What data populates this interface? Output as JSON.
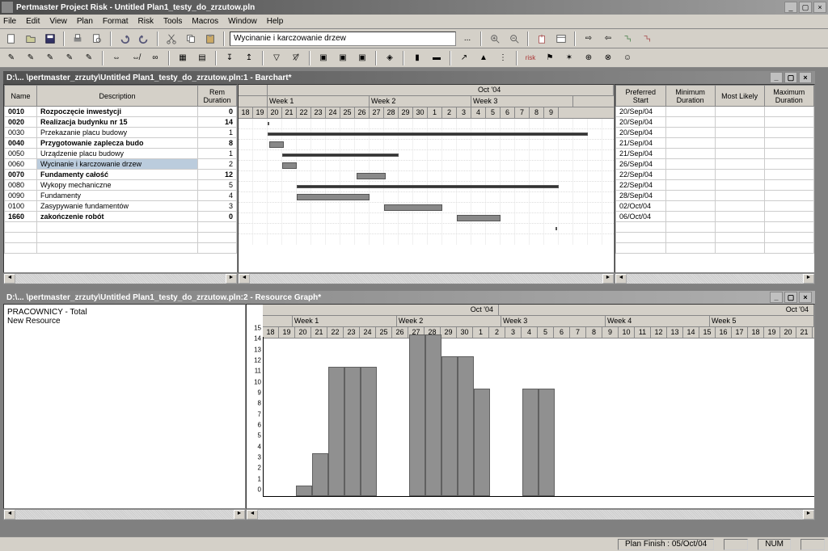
{
  "app": {
    "title": "Pertmaster Project Risk - Untitled Plan1_testy_do_zrzutow.pln"
  },
  "menu": [
    "File",
    "Edit",
    "View",
    "Plan",
    "Format",
    "Risk",
    "Tools",
    "Macros",
    "Window",
    "Help"
  ],
  "toolbar_input": "Wycinanie i karczowanie drzew",
  "win1": {
    "title": "D:\\... \\pertmaster_zrzuty\\Untitled Plan1_testy_do_zrzutow.pln:1 - Barchart*",
    "cols_left": [
      "Name",
      "Description",
      "Rem Duration"
    ],
    "cols_right": [
      "Preferred Start",
      "Minimum Duration",
      "Most Likely",
      "Maximum Duration"
    ],
    "timeline_month": "Oct '04",
    "timeline_weeks": [
      "Week 1",
      "Week 2",
      "Week 3"
    ],
    "timeline_days": [
      "18",
      "19",
      "20",
      "21",
      "22",
      "23",
      "24",
      "25",
      "26",
      "27",
      "28",
      "29",
      "30",
      "1",
      "2",
      "3",
      "4",
      "5",
      "6",
      "7",
      "8",
      "9"
    ],
    "rows": [
      {
        "id": "0010",
        "desc": "Rozpoczęcie inwestycji",
        "dur": "0",
        "start": "20/Sep/04",
        "bold": true
      },
      {
        "id": "0020",
        "desc": "Realizacja budynku nr 15",
        "dur": "14",
        "start": "20/Sep/04",
        "bold": true
      },
      {
        "id": "0030",
        "desc": "Przekazanie placu budowy",
        "dur": "1",
        "start": "20/Sep/04"
      },
      {
        "id": "0040",
        "desc": "Przygotowanie zaplecza budo",
        "dur": "8",
        "start": "21/Sep/04",
        "bold": true
      },
      {
        "id": "0050",
        "desc": "Urządzenie placu budowy",
        "dur": "1",
        "start": "21/Sep/04"
      },
      {
        "id": "0060",
        "desc": "Wycinanie i karczowanie drzew",
        "dur": "2",
        "start": "26/Sep/04",
        "hl": true
      },
      {
        "id": "0070",
        "desc": "Fundamenty całość",
        "dur": "12",
        "start": "22/Sep/04",
        "bold": true
      },
      {
        "id": "0080",
        "desc": "Wykopy mechaniczne",
        "dur": "5",
        "start": "22/Sep/04"
      },
      {
        "id": "0090",
        "desc": "Fundamenty",
        "dur": "4",
        "start": "28/Sep/04"
      },
      {
        "id": "0100",
        "desc": "Zasypywanie fundamentów",
        "dur": "3",
        "start": "02/Oct/04"
      },
      {
        "id": "1660",
        "desc": "zakończenie robót",
        "dur": "0",
        "start": "06/Oct/04",
        "bold": true
      }
    ]
  },
  "win2": {
    "title": "D:\\... \\pertmaster_zrzuty\\Untitled Plan1_testy_do_zrzutow.pln:2 - Resource Graph*",
    "resource1": "PRACOWNICY - Total",
    "resource2": "New Resource",
    "timeline_month1": "Oct '04",
    "timeline_month2": "Oct '04",
    "timeline_weeks": [
      "Week 1",
      "Week 2",
      "Week 3",
      "Week 4",
      "Week 5"
    ],
    "timeline_days": [
      "18",
      "19",
      "20",
      "21",
      "22",
      "23",
      "24",
      "25",
      "26",
      "27",
      "28",
      "29",
      "30",
      "1",
      "2",
      "3",
      "4",
      "5",
      "6",
      "7",
      "8",
      "9",
      "10",
      "11",
      "12",
      "13",
      "14",
      "15",
      "16",
      "17",
      "18",
      "19",
      "20",
      "21"
    ]
  },
  "chart_data": {
    "type": "bar",
    "title": "PRACOWNICY - Total",
    "ylabel": "",
    "ylim": [
      0,
      15
    ],
    "categories": [
      "18",
      "19",
      "20",
      "21",
      "22",
      "23",
      "24",
      "25",
      "26",
      "27",
      "28",
      "29",
      "30",
      "1",
      "2",
      "3",
      "4",
      "5",
      "6",
      "7",
      "8",
      "9"
    ],
    "values": [
      0,
      0,
      1,
      4,
      12,
      12,
      12,
      0,
      0,
      15,
      15,
      13,
      13,
      10,
      0,
      0,
      10,
      10,
      0,
      0,
      0,
      0
    ]
  },
  "status": {
    "plan_finish": "Plan Finish : 05/Oct/04",
    "num": "NUM"
  }
}
